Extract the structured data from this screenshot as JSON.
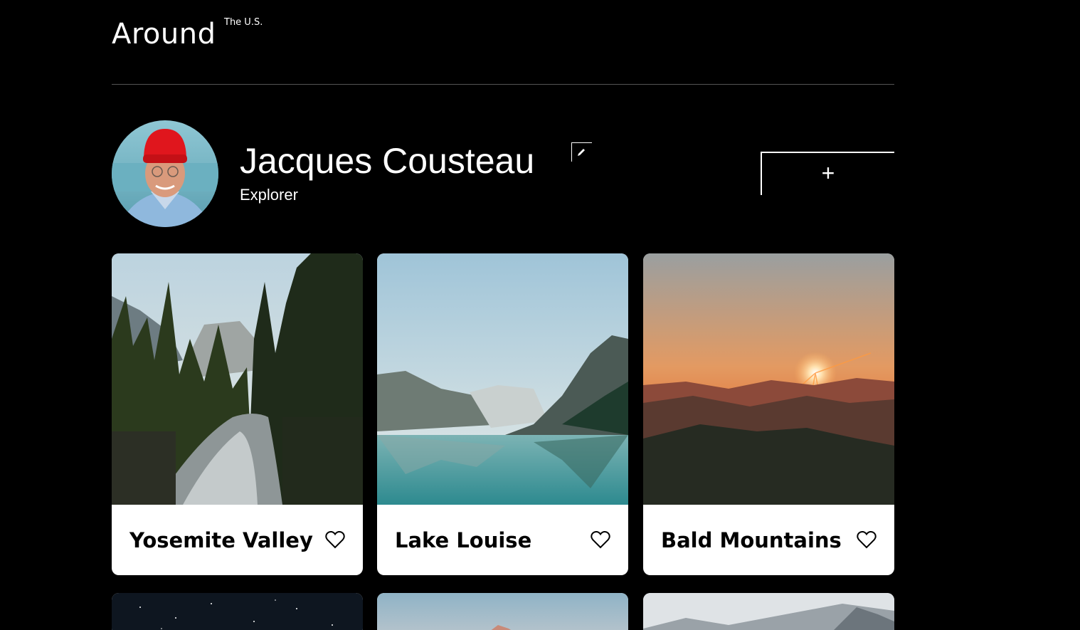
{
  "header": {
    "logo_main": "Around",
    "logo_sup": "The U.S."
  },
  "profile": {
    "name": "Jacques Cousteau",
    "role": "Explorer",
    "add_button_label": "+"
  },
  "cards": [
    {
      "title": "Yosemite Valley",
      "liked": false
    },
    {
      "title": "Lake Louise",
      "liked": false
    },
    {
      "title": "Bald Mountains",
      "liked": false
    }
  ],
  "colors": {
    "background": "#000000",
    "card_background": "#ffffff",
    "divider": "#545454"
  },
  "icons": {
    "edit": "pencil-icon",
    "add": "plus-icon",
    "like": "heart-icon"
  }
}
